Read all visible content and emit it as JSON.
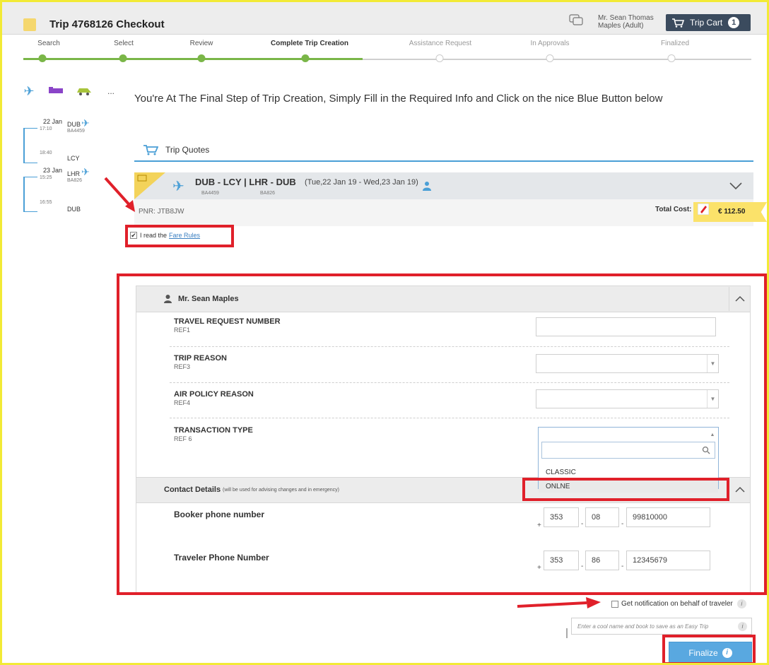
{
  "header": {
    "title": "Trip 4768126 Checkout",
    "user_line1": "Mr. Sean Thomas",
    "user_line2": "Maples (Adult)",
    "cart_label": "Trip Cart",
    "cart_count": "1"
  },
  "steps": [
    {
      "label": "Search",
      "state": "done"
    },
    {
      "label": "Select",
      "state": "done"
    },
    {
      "label": "Review",
      "state": "done"
    },
    {
      "label": "Complete Trip Creation",
      "state": "current"
    },
    {
      "label": "Assistance Request",
      "state": "future"
    },
    {
      "label": "In Approvals",
      "state": "future"
    },
    {
      "label": "Finalized",
      "state": "future"
    }
  ],
  "rail": {
    "icons": [
      "airplane-icon",
      "hotel-icon",
      "car-icon",
      "more-icon"
    ],
    "more_label": "...",
    "leg1": {
      "date": "22 Jan",
      "dep_time": "17:10",
      "dep": "DUB",
      "flight": "BA4459",
      "arr_time": "18:40",
      "arr": "LCY"
    },
    "leg2": {
      "date": "23 Jan",
      "dep_time": "15:25",
      "dep": "LHR",
      "flight": "BA826",
      "arr_time": "16:55",
      "arr": "DUB"
    }
  },
  "main": {
    "headline": "You're At The Final Step of Trip Creation, Simply Fill in the Required Info and Click on the nice Blue Button below",
    "quotes_tab": "Trip Quotes",
    "route": "DUB - LCY | LHR - DUB",
    "dates": "(Tue,22 Jan 19 - Wed,23 Jan 19)",
    "flight1": "BA4459",
    "flight2": "BA826",
    "pnr": "PNR: JTB8JW",
    "total_cost_label": "Total Cost:",
    "total_cost_value": "€ 112.50",
    "fare_read": "I read the",
    "fare_rules_link": "Fare Rules"
  },
  "traveler": {
    "name": "Mr. Sean Maples",
    "fields": [
      {
        "label": "TRAVEL REQUEST NUMBER",
        "ref": "REF1"
      },
      {
        "label": "TRIP REASON",
        "ref": "REF3"
      },
      {
        "label": "AIR POLICY REASON",
        "ref": "REF4"
      },
      {
        "label": "TRANSACTION TYPE",
        "ref": "REF 6"
      }
    ],
    "dropdown_options": [
      "CLASSIC",
      "ONLNE"
    ]
  },
  "contact": {
    "title": "Contact Details",
    "note": "(will be used for advising changes and in emergency)",
    "booker_label": "Booker phone number",
    "booker": {
      "country": "353",
      "area": "08",
      "number": "99810000"
    },
    "traveler_label": "Traveler Phone Number",
    "traveler": {
      "country": "353",
      "area": "86",
      "number": "12345679"
    },
    "plus": "+"
  },
  "footer": {
    "notify_label": "Get notification on behalf of traveler",
    "info_glyph": "i",
    "easytrip_placeholder": "Enter a cool name and book to save as an Easy Trip",
    "finalize_label": "Finalize"
  },
  "colors": {
    "accent_blue": "#59a8e0",
    "progress_green": "#7ab648",
    "annotation_red": "#e0202a",
    "frame_yellow": "#f2ea36",
    "price_yellow": "#fbe26a"
  }
}
